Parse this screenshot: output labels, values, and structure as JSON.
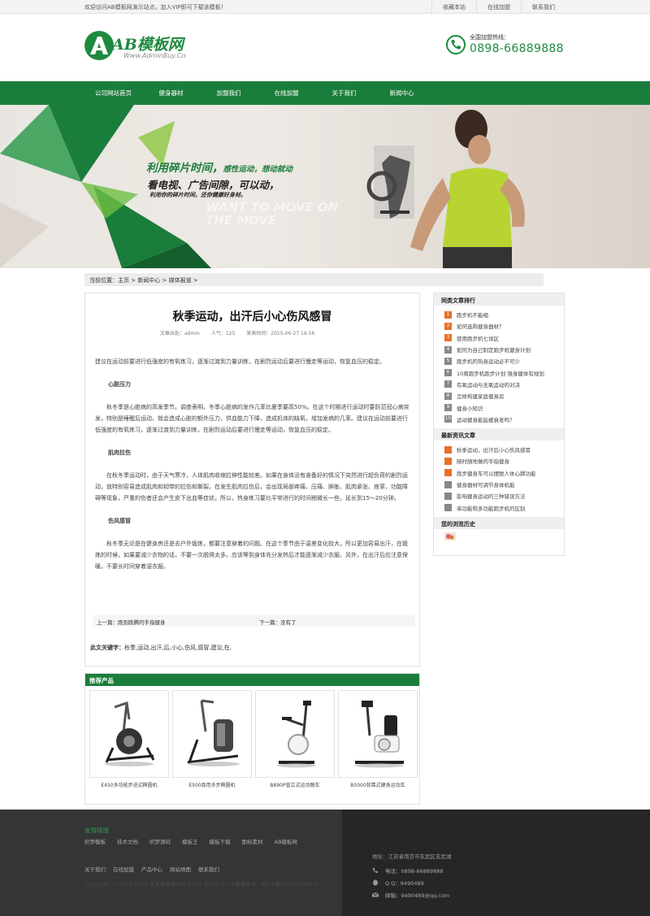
{
  "topbar": {
    "welcome": "欢迎访问AB模板网演示站点，加入VIP即可下载该模板！",
    "links": [
      "收藏本站",
      "在线加盟",
      "联系我们"
    ]
  },
  "logo": {
    "name": "AB模板网",
    "domain": "Www.AdminBuy.Cn"
  },
  "hotline": {
    "label": "全国加盟热线：",
    "number": "0898-66889888"
  },
  "nav": [
    "公司网站首页",
    "健身器材",
    "加盟我们",
    "在线加盟",
    "关于我们",
    "新闻中心"
  ],
  "banner": {
    "line1a": "利用碎片时间，",
    "line1b": "感性运动，想动就动",
    "line2": "看电视、广告间隙，可以动，",
    "line3": "利用你的碎片时间，还你健康好身材。",
    "ghost1": "WANT TO MOVE ON",
    "ghost2": "THE MOVE"
  },
  "breadcrumb": "当前位置：主页 > 新闻中心 > 媒体报道 >",
  "article": {
    "title": "秋季运动，出汗后小心伤风感冒",
    "source": "文章出处：admin",
    "views": "人气：125",
    "date": "发表时间：2015-06-27 16:56",
    "intro": "建议在运动前要进行低强度的有氧练习，逐渐过渡到力量训练，在剧烈运动后要进行慢走等运动，恢复血压的稳定。",
    "h1": "心脏压力",
    "p1": "秋冬季是心脏病的高发季节。调查表明，冬季心脏病的发作几率比夏季要高50%。在这个时期进行运动时要防范冠心病突发，特别是睡醒后运动，就会造成心脏的额外压力，供血能力下降，造成机体的缺氧，增加发病的几率。建议在运动前要进行低强度的有氧练习，逐渐过渡到力量训练，在剧烈运动后要进行慢走等运动，恢复血压的稳定。",
    "h2": "肌肉拉伤",
    "p2": "在秋冬季运动时，由于天气寒冷，人体肌肉收缩拉伸性能较差。如果在身体没有准备好的情况下突然进行超负荷的剧烈运动，就特别容易造成肌肉和韧带的拉伤和撕裂。在发生肌肉拉伤后，会出现局部疼痛、压痛、肿胀、肌肉紧张、痉挛、功能障碍等现象，严重的伤者还会产生皮下出血等症状。所以，热身练习要比平常进行的时间稍微长一些，延长到15～20分钟。",
    "h3": "伤风感冒",
    "p3": "秋冬季无论是在健身房还是去户外锻炼，都要注意穿着的问题。在这个季节由于温差变化较大，所以更加容易出汗，在锻炼的时候，如果要减少衣物的话，不要一次脱得太多。应该等到身体充分发热后才能逐渐减少衣服。另外，在出汗后应注意保暖，不要长时间穿着湿衣服。",
    "prev": "上一篇：跑到跑腾的手指健身",
    "next": "下一篇：没有了",
    "tags_label": "此文关键字：",
    "tags": "秋季,运动,出汗,后,小心,伤风,感冒,建议,在,"
  },
  "sidebar": {
    "rank_title": "同类文章排行",
    "rank": [
      "跑步机不能缩",
      "如何选购健身器材？",
      "使用跑步机七误区",
      "如何为自己制定跑步机健身计划",
      "跑步机的热身运动必不可少",
      "10周跑步机跑步计划 强身健体有规划",
      "有氧运动与无氧运动的对决",
      "怎样构建家庭健身房",
      "健身小知识",
      "运动健身能延缓衰老吗？"
    ],
    "news_title": "最新资讯文章",
    "news": [
      "秋季运动，出汗后小心伤风感冒",
      "随时随地做的手指健身",
      "跑步健身车可以摆脱人体心肺功能",
      "健身器材可调节身体机能",
      "影响健身运动的三种错误方法",
      "单功能和多功能跑步机的区别"
    ],
    "history_title": "您的浏览历史"
  },
  "recommend": {
    "title": "推荐产品",
    "products": [
      "E450多功能步进式椭圆机",
      "E500商用多步椭圆机",
      "B890P直立式运动踏车",
      "B5000背靠式健身运动车"
    ]
  },
  "footer": {
    "title": "友情链接",
    "links": [
      "织梦模板",
      "技术文档",
      "织梦源码",
      "模板王",
      "模板下载",
      "图标素材",
      "AB模板网"
    ],
    "links2": [
      "关于我们",
      "在线加盟",
      "产品中心",
      "网站地图",
      "联系我们"
    ],
    "copy": "Copyright © 2002-2015 某某健身器材有限公司 版权所有 ICP备案编号：琼ICP备12345678号-1",
    "address": "地址：江苏省南京市玄武区玄武湖",
    "tel": "电话：0898-66889888",
    "qq": "Q Q：9490489",
    "email": "邮箱：9490489@qq.com"
  },
  "colors": {
    "brand_green": "#1b7d3b",
    "accent_orange": "#e8702a"
  }
}
